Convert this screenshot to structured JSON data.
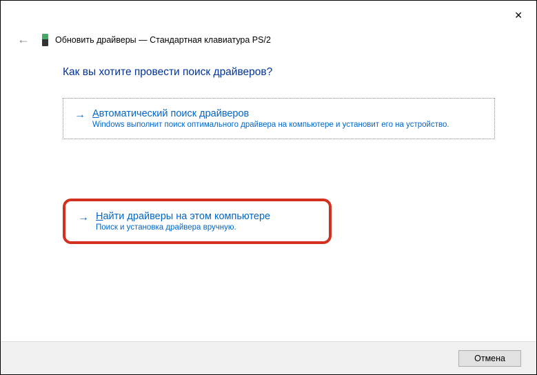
{
  "titlebar": {
    "close_symbol": "✕"
  },
  "header": {
    "back_symbol": "←",
    "title": "Обновить драйверы — Стандартная клавиатура PS/2"
  },
  "heading": "Как вы хотите провести поиск драйверов?",
  "option1": {
    "arrow": "→",
    "title_prefix": "А",
    "title_rest": "втоматический поиск драйверов",
    "description": "Windows выполнит поиск оптимального драйвера на компьютере и установит его на устройство."
  },
  "option2": {
    "arrow": "→",
    "title_prefix": "Н",
    "title_rest": "айти драйверы на этом компьютере",
    "description": "Поиск и установка драйвера вручную."
  },
  "footer": {
    "cancel_label": "Отмена"
  }
}
